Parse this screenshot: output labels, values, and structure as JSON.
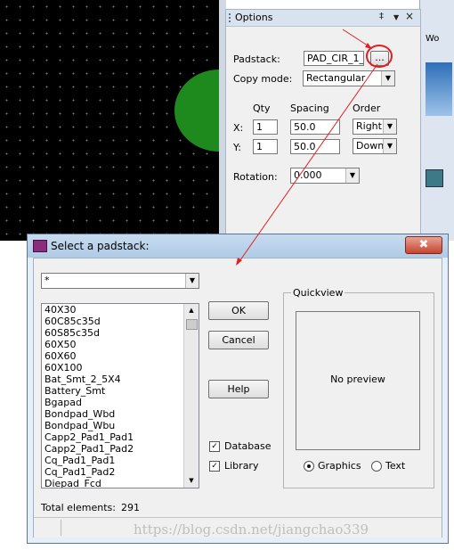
{
  "options_panel": {
    "title": "Options",
    "pin_glyph": "‡",
    "close_glyph": "×",
    "padstack_label": "Padstack:",
    "padstack_value": "PAD_CIR_1_",
    "browse_label": "...",
    "copy_mode_label": "Copy mode:",
    "copy_mode_value": "Rectangular",
    "qty_header": "Qty",
    "spacing_header": "Spacing",
    "order_header": "Order",
    "x_label": "X:",
    "y_label": "Y:",
    "x_qty": "1",
    "y_qty": "1",
    "x_spacing": "50.0",
    "y_spacing": "50.0",
    "x_order": "Right",
    "y_order": "Down",
    "rotation_label": "Rotation:",
    "rotation_value": "0.000"
  },
  "background_app": {
    "strip_text": "Wo"
  },
  "dialog": {
    "title": "Select a padstack:",
    "close_label": "✖",
    "filter_value": "*",
    "items": [
      "40X30",
      "60C85c35d",
      "60S85c35d",
      "60X50",
      "60X60",
      "60X100",
      "Bat_Smt_2_5X4",
      "Battery_Smt",
      "Bgapad",
      "Bondpad_Wbd",
      "Bondpad_Wbu",
      "Capp2_Pad1_Pad1",
      "Capp2_Pad1_Pad2",
      "Cq_Pad1_Pad1",
      "Cq_Pad1_Pad2",
      "Diepad_Fcd"
    ],
    "ok_label": "OK",
    "cancel_label": "Cancel",
    "help_label": "Help",
    "database_label": "Database",
    "library_label": "Library",
    "quickview_label": "Quickview",
    "preview_text": "No preview",
    "graphics_label": "Graphics",
    "text_label": "Text",
    "total_label": "Total elements:",
    "total_value": "291"
  },
  "watermark": "https://blog.csdn.net/jiangchao339",
  "colors": {
    "pad_green": "#1e8a1e",
    "canvas_black": "#000000",
    "annotation_red": "#e02020"
  }
}
